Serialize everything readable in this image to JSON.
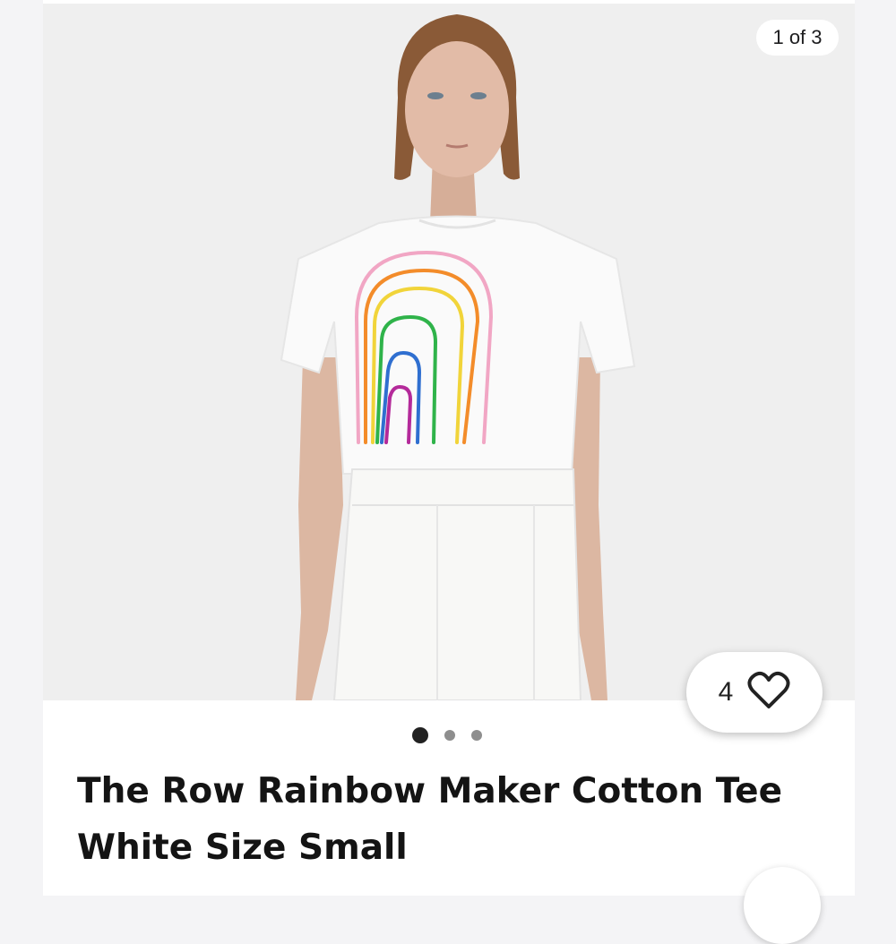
{
  "gallery": {
    "counter": "1 of 3",
    "image_alt": "Model wearing a white tee with a hand-drawn rainbow",
    "total_slides": 3,
    "active_slide": 1
  },
  "favorite": {
    "count": "4",
    "icon": "heart-outline-icon"
  },
  "product": {
    "title": "The Row Rainbow Maker Cotton Tee White Size Small"
  },
  "corner_button": {
    "icon": "search-icon"
  }
}
